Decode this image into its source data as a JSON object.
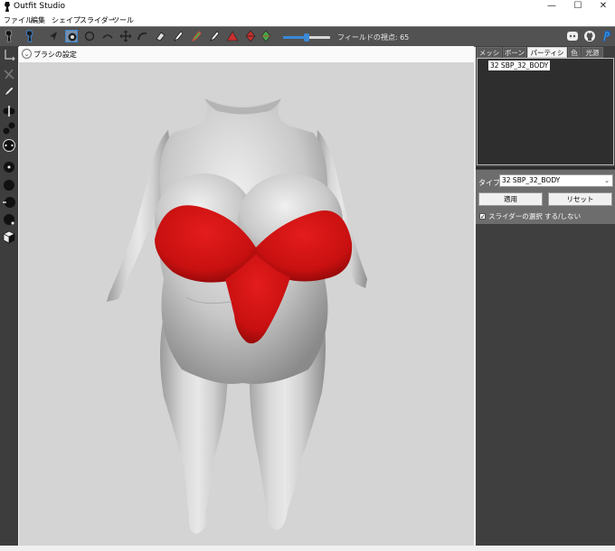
{
  "window": {
    "title": "Outfit Studio",
    "controls": {
      "minimize": "—",
      "maximize": "☐",
      "close": "✕"
    }
  },
  "menu": [
    "ファイル",
    "編集",
    "シェイプ",
    "スライダー",
    "ツール"
  ],
  "toolbar": {
    "buttons": [
      "select-tool",
      "transform-tool",
      "pivot-tool",
      "vertex-select-tool",
      "weight-brush",
      "mask-brush",
      "inflate-brush",
      "deflate-brush",
      "move-brush",
      "smooth-brush",
      "undiff-brush",
      "color-brush",
      "alpha-brush",
      "collapse-vertex",
      "flip-edge",
      "split-edge"
    ],
    "fov_label": "フィールドの視点: 65",
    "fov_value": 65,
    "fov_fraction": 0.5,
    "icons": [
      "discord-icon",
      "github-icon",
      "paypal-icon"
    ]
  },
  "viewport": {
    "brush_settings_label": "ブラシの設定"
  },
  "right_panel": {
    "tabs": [
      "メッシュ",
      "ボーン",
      "パーティション",
      "色",
      "光源"
    ],
    "active_tab": "パーティション",
    "partition_item": "32 SBP_32_BODY",
    "type_label": "タイプ",
    "type_value": "32 SBP_32_BODY",
    "apply_button": "適用",
    "reset_button": "リセット",
    "slider_checkbox_label": "スライダーの選択 する/しない"
  },
  "colors": {
    "accent": "#3b89d6",
    "mesh_red": "#d01515",
    "toolbar_bg": "#525252"
  }
}
